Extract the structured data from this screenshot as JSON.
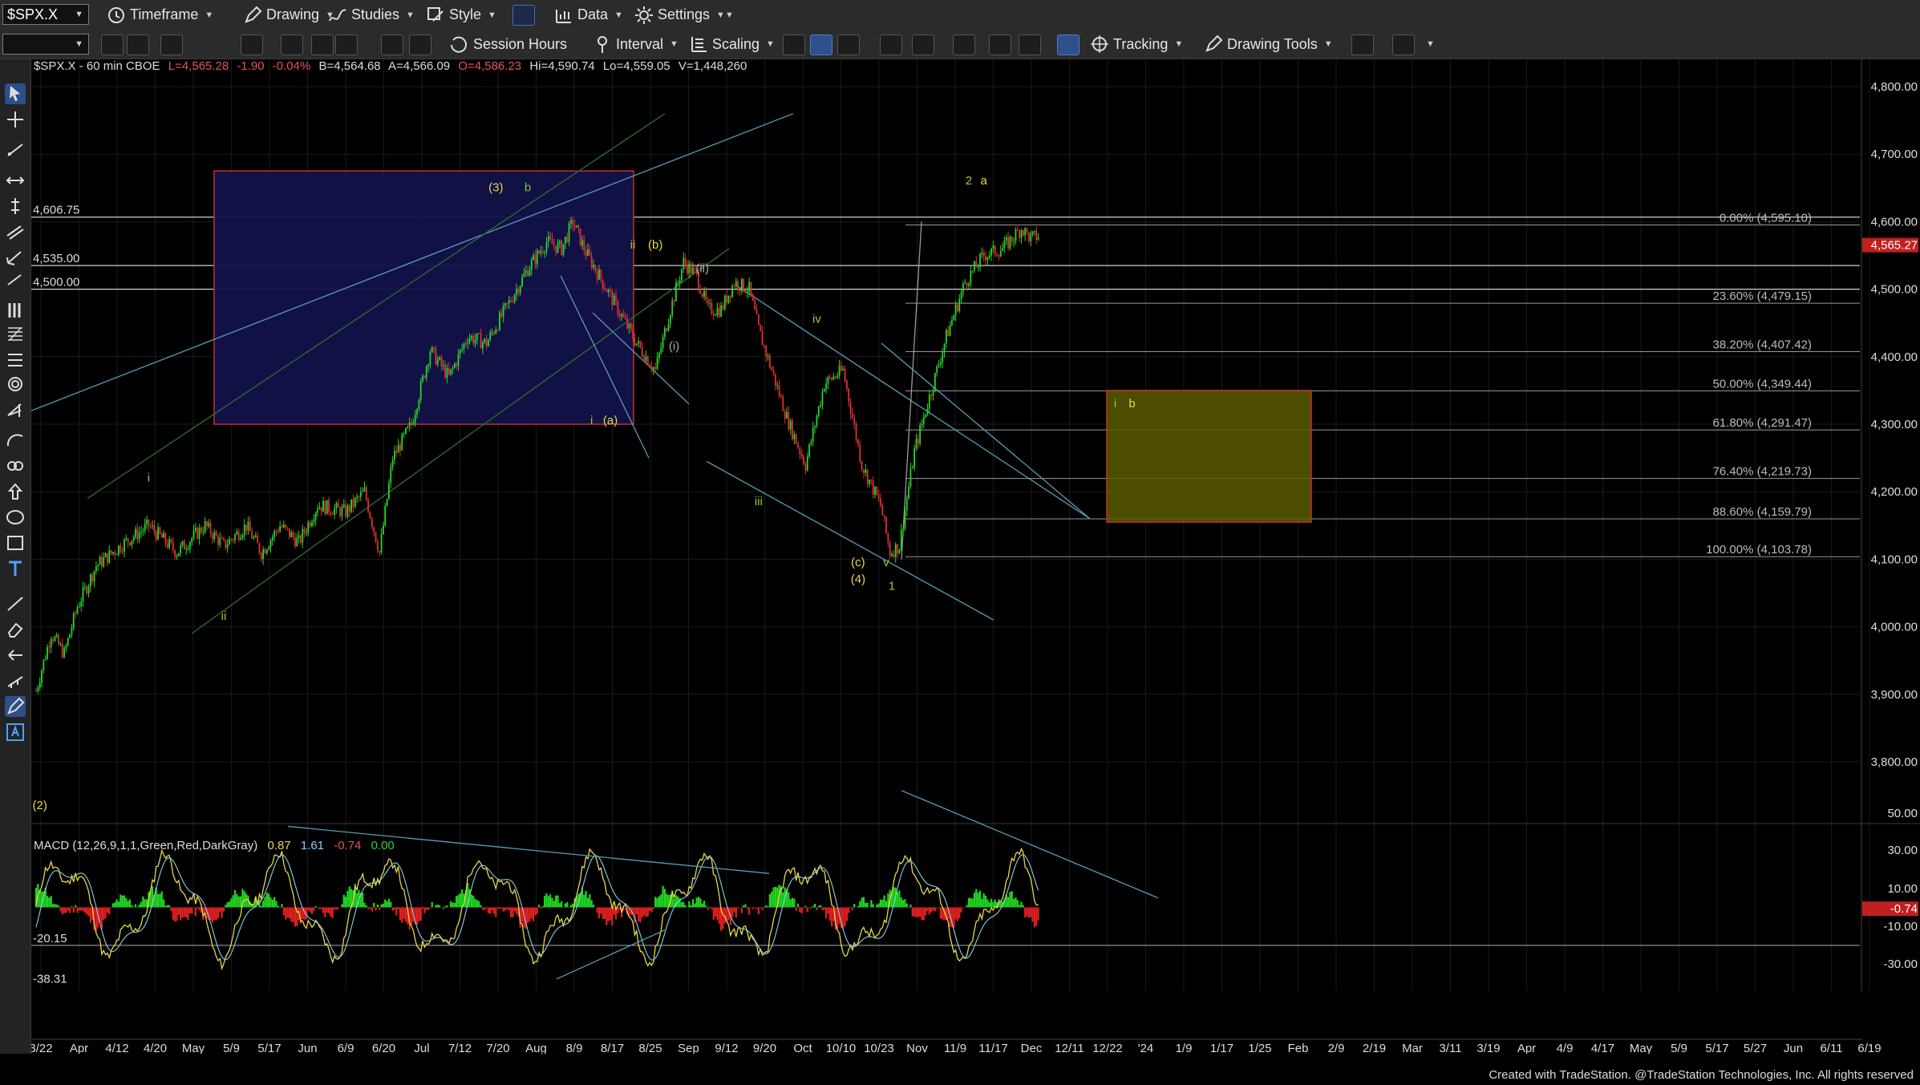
{
  "toolbar1": {
    "symbol": "$SPX.X",
    "timeframe": "Timeframe",
    "drawing": "Drawing",
    "studies": "Studies",
    "style": "Style",
    "data": "Data",
    "settings": "Settings"
  },
  "toolbar2": {
    "interval_value": "",
    "session_hours": "Session Hours",
    "interval": "Interval",
    "scaling": "Scaling",
    "tracking": "Tracking",
    "drawing_tools": "Drawing Tools"
  },
  "info": {
    "symbol_line": "$SPX.X - 60 min  CBOE",
    "last": "L=4,565.28",
    "net": "-1.90",
    "pct": "-0.04%",
    "bid": "B=4,564.68",
    "ask": "A=4,566.09",
    "open": "O=4,586.23",
    "high": "Hi=4,590.74",
    "low": "Lo=4,559.05",
    "volume": "V=1,448,260"
  },
  "macd": {
    "label": "MACD (12,26,9,1,1,Green,Red,DarkGray)",
    "v1": "0.87",
    "v2": "1.61",
    "v3": "-0.74",
    "v4": "0.00",
    "level_top": "-20.15",
    "level_bottom": "-38.31",
    "axis": [
      "50.00",
      "30.00",
      "10.00",
      "-10.00",
      "-30.00"
    ],
    "current": "-0.74"
  },
  "chart_data": {
    "type": "candlestick",
    "symbol": "$SPX.X",
    "interval": "60 min",
    "y_axis": [
      "4,800.00",
      "4,700.00",
      "4,600.00",
      "4,500.00",
      "4,400.00",
      "4,300.00",
      "4,200.00",
      "4,100.00",
      "4,000.00",
      "3,900.00",
      "3,800.00"
    ],
    "ylim": [
      3700,
      4830
    ],
    "last_price": "4,565.27",
    "x_labels": [
      "3/22",
      "Apr",
      "4/12",
      "4/20",
      "May",
      "5/9",
      "5/17",
      "Jun",
      "6/9",
      "6/20",
      "Jul",
      "7/12",
      "7/20",
      "Aug",
      "8/9",
      "8/17",
      "8/25",
      "Sep",
      "9/12",
      "9/20",
      "Oct",
      "10/10",
      "10/23",
      "Nov",
      "11/9",
      "11/17",
      "Dec",
      "12/11",
      "12/22",
      "'24",
      "1/9",
      "1/17",
      "1/25",
      "Feb",
      "2/9",
      "2/19",
      "Mar",
      "3/11",
      "3/19",
      "Apr",
      "4/9",
      "4/17",
      "May",
      "5/9",
      "5/17",
      "5/27",
      "Jun",
      "6/11",
      "6/19"
    ],
    "horizontal_levels": [
      {
        "label": "4,606.75",
        "value": 4606.75
      },
      {
        "label": "4,535.00",
        "value": 4535
      },
      {
        "label": "4,500.00",
        "value": 4500
      }
    ],
    "fib_levels": [
      {
        "label": "0.00% (4,595.10)",
        "value": 4595.1
      },
      {
        "label": "23.60% (4,479.15)",
        "value": 4479.15
      },
      {
        "label": "38.20% (4,407.42)",
        "value": 4407.42
      },
      {
        "label": "50.00% (4,349.44)",
        "value": 4349.44
      },
      {
        "label": "61.80% (4,291.47)",
        "value": 4291.47
      },
      {
        "label": "76.40% (4,219.73)",
        "value": 4219.73
      },
      {
        "label": "88.60% (4,159.79)",
        "value": 4159.79
      },
      {
        "label": "100.00% (4,103.78)",
        "value": 4103.78
      }
    ],
    "path_points": [
      [
        0,
        3905
      ],
      [
        8,
        3990
      ],
      [
        15,
        3960
      ],
      [
        22,
        4030
      ],
      [
        32,
        4090
      ],
      [
        45,
        4120
      ],
      [
        60,
        4150
      ],
      [
        75,
        4110
      ],
      [
        90,
        4150
      ],
      [
        100,
        4120
      ],
      [
        112,
        4150
      ],
      [
        120,
        4110
      ],
      [
        130,
        4150
      ],
      [
        140,
        4125
      ],
      [
        150,
        4180
      ],
      [
        165,
        4170
      ],
      [
        175,
        4200
      ],
      [
        183,
        4110
      ],
      [
        190,
        4250
      ],
      [
        200,
        4300
      ],
      [
        210,
        4410
      ],
      [
        220,
        4370
      ],
      [
        230,
        4430
      ],
      [
        240,
        4420
      ],
      [
        250,
        4470
      ],
      [
        262,
        4530
      ],
      [
        272,
        4570
      ],
      [
        280,
        4560
      ],
      [
        286,
        4600
      ],
      [
        292,
        4560
      ],
      [
        300,
        4520
      ],
      [
        310,
        4470
      ],
      [
        320,
        4420
      ],
      [
        330,
        4380
      ],
      [
        338,
        4470
      ],
      [
        345,
        4540
      ],
      [
        352,
        4520
      ],
      [
        358,
        4470
      ],
      [
        365,
        4470
      ],
      [
        372,
        4510
      ],
      [
        380,
        4500
      ],
      [
        385,
        4440
      ],
      [
        392,
        4380
      ],
      [
        400,
        4310
      ],
      [
        410,
        4240
      ],
      [
        420,
        4360
      ],
      [
        430,
        4380
      ],
      [
        440,
        4240
      ],
      [
        450,
        4180
      ],
      [
        455,
        4110
      ],
      [
        460,
        4120
      ],
      [
        468,
        4260
      ],
      [
        475,
        4330
      ],
      [
        485,
        4430
      ],
      [
        495,
        4510
      ],
      [
        505,
        4550
      ],
      [
        515,
        4560
      ],
      [
        525,
        4590
      ],
      [
        530,
        4575
      ],
      [
        535,
        4580
      ]
    ],
    "labels": [
      {
        "text": "(2)",
        "date_index": 2,
        "value": 3730,
        "color": "#e6d84a"
      },
      {
        "text": "i",
        "date_index": 60,
        "value": 4215,
        "color": "#9acd32"
      },
      {
        "text": "ii",
        "date_index": 100,
        "value": 4010,
        "color": "#9acd32"
      },
      {
        "text": "(3)",
        "date_index": 245,
        "value": 4645,
        "color": "#e6d84a"
      },
      {
        "text": "b",
        "date_index": 262,
        "value": 4645,
        "color": "#6ccb3a"
      },
      {
        "text": "ii",
        "date_index": 318,
        "value": 4560,
        "color": "#9acd32"
      },
      {
        "text": "(b)",
        "date_index": 330,
        "value": 4560,
        "color": "#e6d84a"
      },
      {
        "text": "(ii)",
        "date_index": 355,
        "value": 4525,
        "color": "#aaaaaa"
      },
      {
        "text": "(i)",
        "date_index": 340,
        "value": 4410,
        "color": "#aaaaaa"
      },
      {
        "text": "i",
        "date_index": 296,
        "value": 4300,
        "color": "#9acd32"
      },
      {
        "text": "(a)",
        "date_index": 306,
        "value": 4300,
        "color": "#e6d84a"
      },
      {
        "text": "iv",
        "date_index": 416,
        "value": 4450,
        "color": "#9acd32"
      },
      {
        "text": "iii",
        "date_index": 385,
        "value": 4180,
        "color": "#9acd32"
      },
      {
        "text": "(c)",
        "date_index": 438,
        "value": 4090,
        "color": "#e6d84a"
      },
      {
        "text": "(4)",
        "date_index": 438,
        "value": 4065,
        "color": "#e6d84a"
      },
      {
        "text": "v",
        "date_index": 453,
        "value": 4090,
        "color": "#9acd32"
      },
      {
        "text": "1",
        "date_index": 456,
        "value": 4055,
        "color": "#9acd32"
      },
      {
        "text": "2",
        "date_index": 497,
        "value": 4655,
        "color": "#9acd32"
      },
      {
        "text": "a",
        "date_index": 505,
        "value": 4655,
        "color": "#e6d84a"
      },
      {
        "text": "i",
        "date_index": 575,
        "value": 4325,
        "color": "#9acd32"
      },
      {
        "text": "b",
        "date_index": 584,
        "value": 4325,
        "color": "#e6d84a"
      }
    ]
  },
  "footer": "Created with TradeStation. @TradeStation Technologies, Inc. All rights reserved"
}
